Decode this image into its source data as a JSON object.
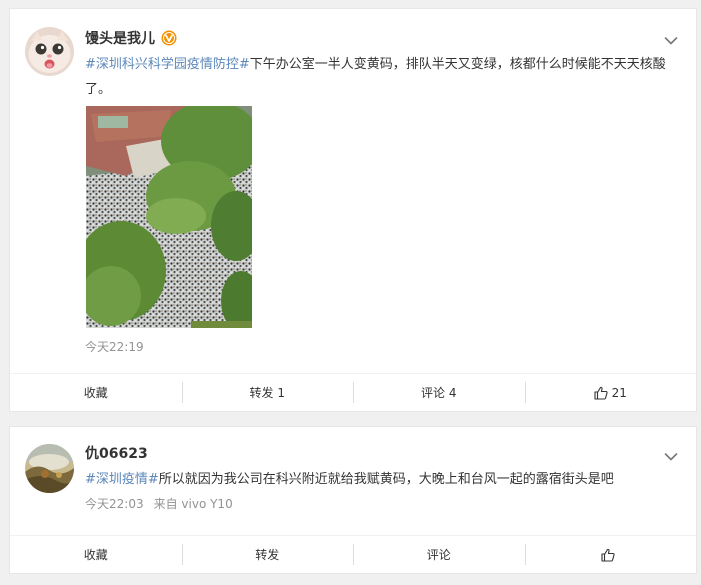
{
  "posts": [
    {
      "author": "馒头是我儿",
      "verified": true,
      "avatar_icon": "cat-face-avatar",
      "hashtag": "#深圳科兴科学园疫情防控#",
      "text": "下午办公室一半人变黄码，排队半天又变绿，核都什么时候能不天天核酸了。",
      "image_icon": "aerial-crowd-photo",
      "timestamp": "今天22:19",
      "source": "",
      "actions": {
        "favorite": "收藏",
        "repost": "转发 1",
        "comment": "评论 4",
        "like": "21"
      }
    },
    {
      "author": "仇06623",
      "verified": false,
      "avatar_icon": "landscape-avatar",
      "hashtag": "#深圳疫情#",
      "text": "所以就因为我公司在科兴附近就给我赋黄码，大晚上和台风一起的露宿街头是吧",
      "timestamp": "今天22:03",
      "source": "来自 vivo Y10",
      "actions": {
        "favorite": "收藏",
        "repost": "转发",
        "comment": "评论",
        "like": ""
      }
    }
  ],
  "colors": {
    "background": "#f0f0f0",
    "hashtag": "#5b87b9",
    "meta": "#939393",
    "verified_badge": "#f29100"
  }
}
